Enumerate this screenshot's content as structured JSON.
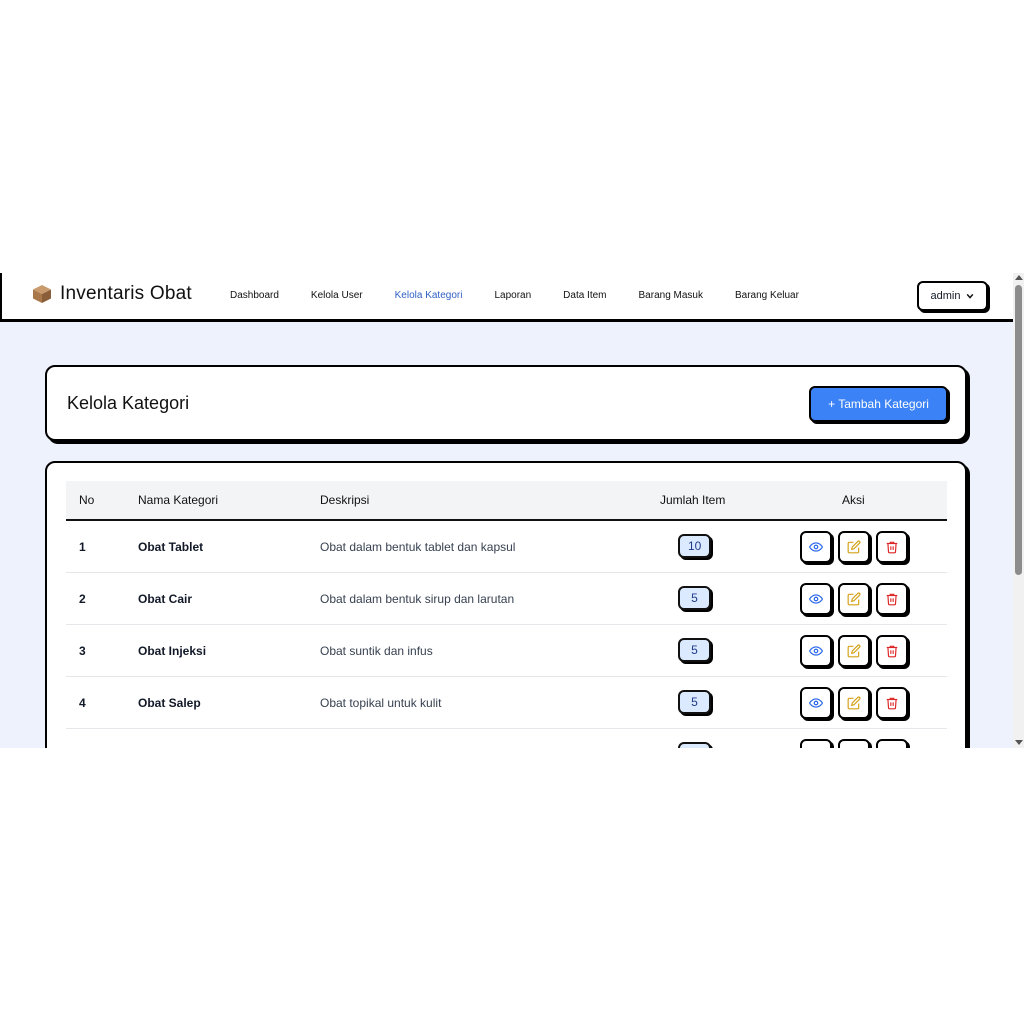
{
  "app": {
    "title": "Inventaris Obat"
  },
  "nav": {
    "links": [
      {
        "label": "Dashboard"
      },
      {
        "label": "Kelola User"
      },
      {
        "label": "Kelola Kategori",
        "active": true
      },
      {
        "label": "Laporan"
      },
      {
        "label": "Data Item"
      },
      {
        "label": "Barang Masuk"
      },
      {
        "label": "Barang Keluar"
      }
    ],
    "user": "admin"
  },
  "header": {
    "title": "Kelola Kategori",
    "add_label": "+ Tambah Kategori"
  },
  "table": {
    "columns": [
      "No",
      "Nama Kategori",
      "Deskripsi",
      "Jumlah Item",
      "Aksi"
    ],
    "rows": [
      {
        "no": "1",
        "name": "Obat Tablet",
        "desc": "Obat dalam bentuk tablet dan kapsul",
        "count": "10"
      },
      {
        "no": "2",
        "name": "Obat Cair",
        "desc": "Obat dalam bentuk sirup dan larutan",
        "count": "5"
      },
      {
        "no": "3",
        "name": "Obat Injeksi",
        "desc": "Obat suntik dan infus",
        "count": "5"
      },
      {
        "no": "4",
        "name": "Obat Salep",
        "desc": "Obat topikal untuk kulit",
        "count": "5"
      }
    ]
  },
  "colors": {
    "accent": "#3b82f6",
    "active_nav": "#2f5fc4",
    "page_bg": "#eef2fc",
    "view": "#2563eb",
    "edit": "#d4a017",
    "delete": "#dc2626"
  },
  "icons": {
    "brand": "box-icon",
    "view": "eye-icon",
    "edit": "edit-icon",
    "delete": "trash-icon"
  }
}
